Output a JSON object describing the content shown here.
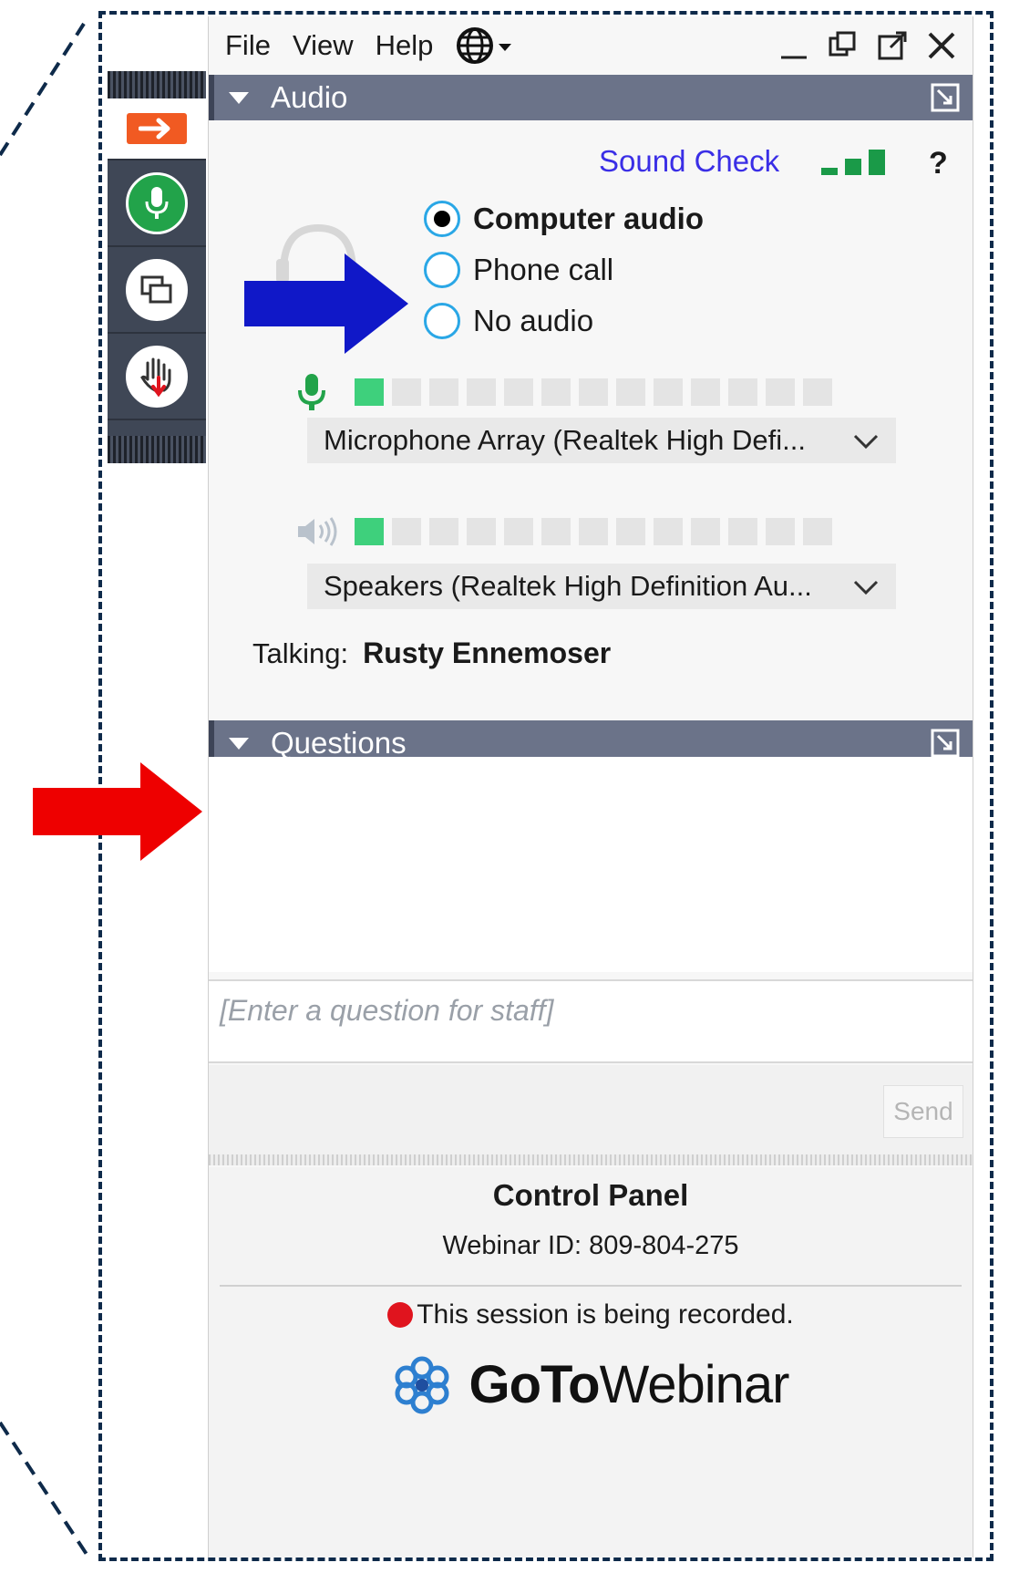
{
  "menu": {
    "file": "File",
    "view": "View",
    "help": "Help"
  },
  "audio_section": {
    "title": "Audio"
  },
  "sound_check": {
    "label": "Sound Check",
    "help": "?"
  },
  "audio_options": [
    {
      "label": "Computer audio",
      "selected": true
    },
    {
      "label": "Phone call",
      "selected": false
    },
    {
      "label": "No audio",
      "selected": false
    }
  ],
  "microphone": {
    "selected": "Microphone Array (Realtek High Defi...",
    "level": 1
  },
  "speakers": {
    "selected": "Speakers (Realtek High Definition Au...",
    "level": 1
  },
  "level_meter_segments": 13,
  "talking": {
    "label": "Talking:",
    "name": "Rusty Ennemoser"
  },
  "questions_section": {
    "title": "Questions"
  },
  "question_input": {
    "placeholder": "[Enter a question for staff]"
  },
  "send_label": "Send",
  "footer": {
    "title": "Control Panel",
    "webinar_id": "Webinar ID: 809-804-275",
    "recording": "This session is being recorded.",
    "brand_goto": "GoTo",
    "brand_webinar": "Webinar"
  },
  "colors": {
    "section_header": "#6b7389",
    "sound_check_link": "#3a2ee6",
    "radio_ring": "#2aa7e6",
    "level_on": "#3ed07c",
    "mic_green": "#22a34a",
    "orange_arrow_button": "#f15a22",
    "callout_blue": "#1018c8",
    "callout_red": "#ee0000",
    "record_dot": "#e0141e"
  },
  "icons": [
    "globe-icon",
    "minimize-icon",
    "restore-icon",
    "popout-icon",
    "close-icon",
    "collapse-triangle-icon",
    "signal-bars-icon",
    "headset-icon",
    "microphone-icon",
    "speaker-icon",
    "chevron-down-icon",
    "screen-share-icon",
    "raise-hand-icon",
    "gotowebinar-logo-icon"
  ]
}
